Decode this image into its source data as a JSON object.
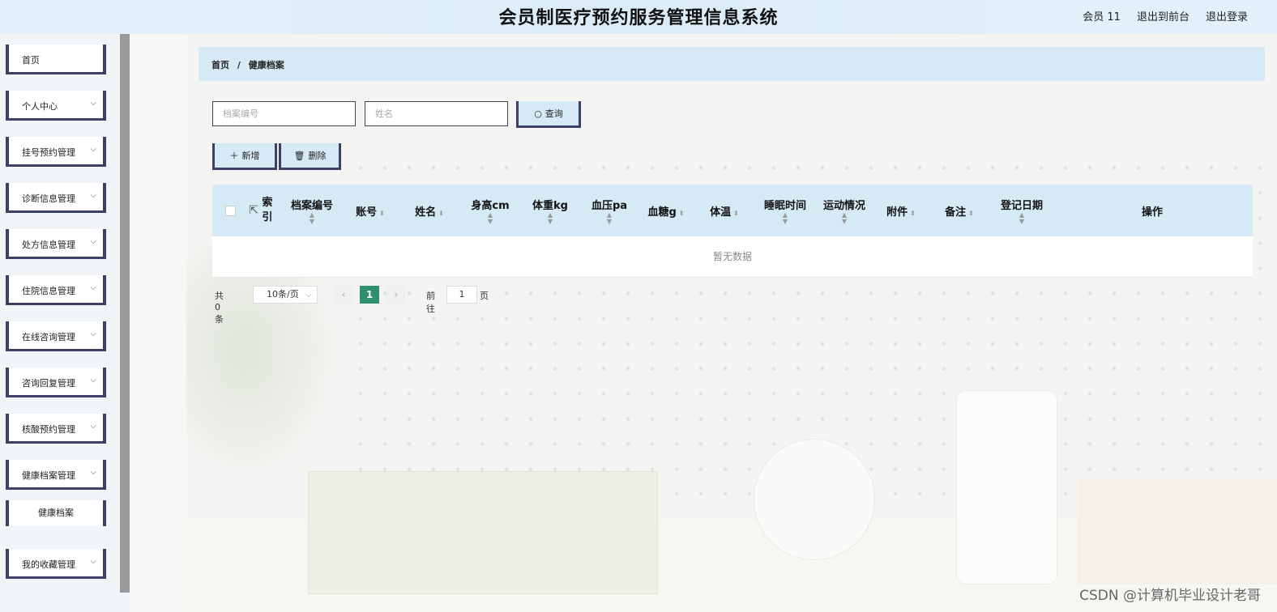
{
  "header": {
    "title": "会员制医疗预约服务管理信息系统",
    "user": "会员 11",
    "back_front": "退出到前台",
    "logout": "退出登录"
  },
  "sidebar": {
    "items": [
      {
        "label": "首页",
        "has_arrow": false
      },
      {
        "label": "个人中心",
        "has_arrow": true
      },
      {
        "label": "挂号预约管理",
        "has_arrow": true
      },
      {
        "label": "诊断信息管理",
        "has_arrow": true
      },
      {
        "label": "处方信息管理",
        "has_arrow": true
      },
      {
        "label": "住院信息管理",
        "has_arrow": true
      },
      {
        "label": "在线咨询管理",
        "has_arrow": true
      },
      {
        "label": "咨询回复管理",
        "has_arrow": true
      },
      {
        "label": "核酸预约管理",
        "has_arrow": true
      },
      {
        "label": "健康档案管理",
        "has_arrow": true
      },
      {
        "label": "我的收藏管理",
        "has_arrow": true
      }
    ],
    "sub_item": "健康档案"
  },
  "breadcrumb": {
    "home": "首页",
    "sep": "/",
    "current": "健康档案"
  },
  "search": {
    "file_no_placeholder": "档案编号",
    "name_placeholder": "姓名",
    "query_label": "查询"
  },
  "actions": {
    "add_label": "新增",
    "delete_label": "删除"
  },
  "table": {
    "columns": [
      "索引",
      "档案编号",
      "账号",
      "姓名",
      "身高cm",
      "体重kg",
      "血压pa",
      "血糖g",
      "体温",
      "睡眠时间",
      "运动情况",
      "附件",
      "备注",
      "登记日期",
      "操作"
    ],
    "empty_text": "暂无数据"
  },
  "pagination": {
    "total": "共 0 条",
    "page_size": "10条/页",
    "current_page": "1",
    "goto_label": "前往",
    "goto_value": "1",
    "page_suffix": "页"
  },
  "watermark": "CSDN @计算机毕业设计老哥",
  "colors": {
    "accent": "#3d3f66",
    "header_bg": "#d6eaf6",
    "page_active": "#2f8f6e"
  }
}
